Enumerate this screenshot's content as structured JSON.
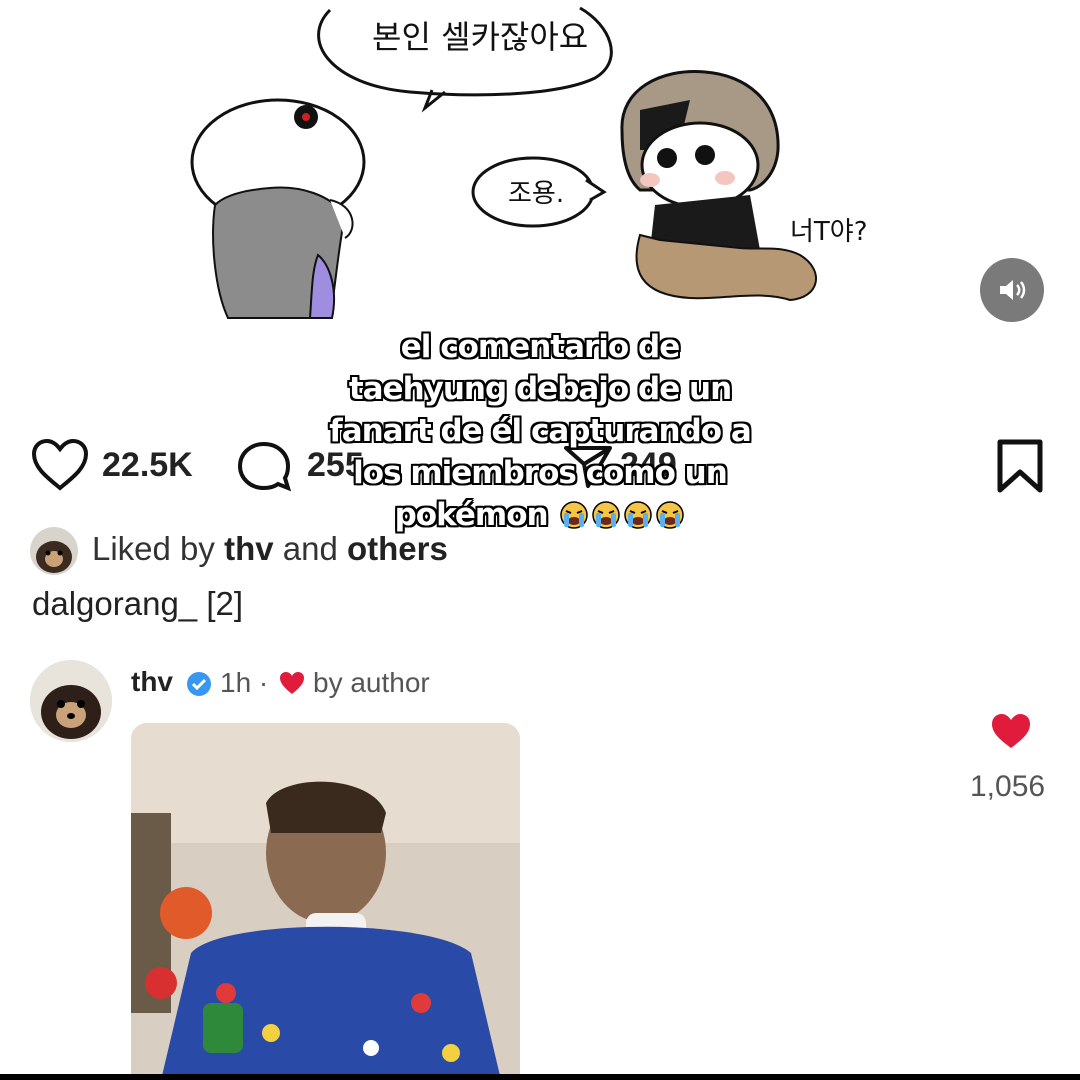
{
  "drawing": {
    "bubble_top": "본인 셀카잖아요",
    "bubble_mid": "조용.",
    "side_text": "너T야?"
  },
  "caption": {
    "lines": [
      "el comentario de",
      "taehyung debajo de un",
      "fanart de él capturando a",
      "los miembros como un",
      "pokémon"
    ],
    "emoji": "😭😭😭😭"
  },
  "sound_icon": "speaker-icon",
  "actions": {
    "likes": "22.5K",
    "comments": "255",
    "shares": "249"
  },
  "liked_by": {
    "prefix": "Liked by ",
    "user": "thv",
    "middle": " and ",
    "suffix": "others"
  },
  "post_author_line": "dalgorang_ [2]",
  "comment": {
    "username": "thv",
    "time": "1h ·",
    "liked_by_author": "by author",
    "like_count": "1,056"
  },
  "colors": {
    "heart_red": "#e01b3c",
    "verified_blue": "#3897f0",
    "sound_bg": "#7a7a7a"
  }
}
